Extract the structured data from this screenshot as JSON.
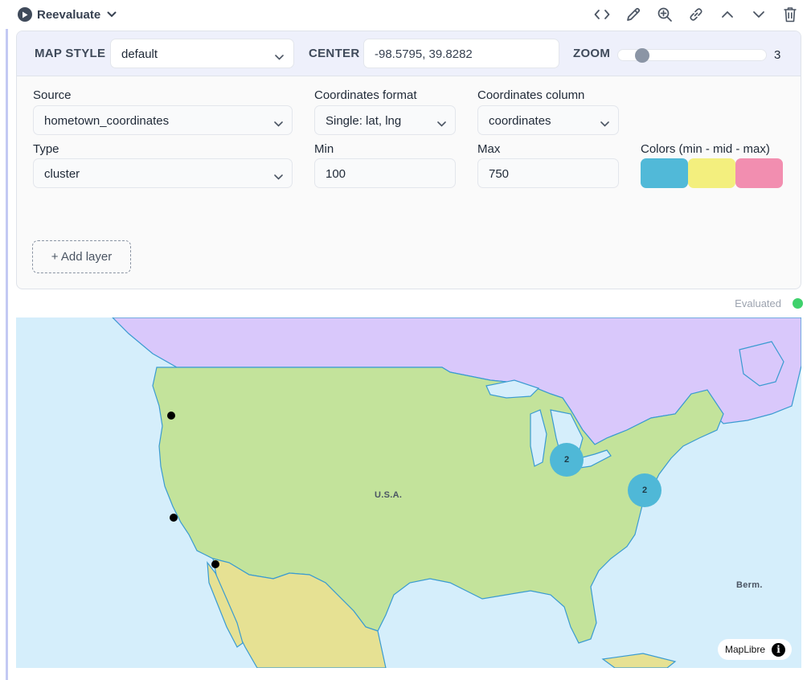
{
  "toolbar": {
    "reevaluate_label": "Reevaluate",
    "actions": [
      "code-icon",
      "pencil-icon",
      "zoom-in-icon",
      "link-icon",
      "chevron-up-icon",
      "chevron-down-icon",
      "trash-icon"
    ]
  },
  "map_config": {
    "map_style_label": "MAP STYLE",
    "map_style_value": "default",
    "center_label": "CENTER",
    "center_value": "-98.5795, 39.8282",
    "zoom_label": "ZOOM",
    "zoom_value": "3"
  },
  "layer": {
    "source_label": "Source",
    "source_value": "hometown_coordinates",
    "coord_format_label": "Coordinates format",
    "coord_format_value": "Single: lat, lng",
    "coord_column_label": "Coordinates column",
    "coord_column_value": "coordinates",
    "type_label": "Type",
    "type_value": "cluster",
    "min_label": "Min",
    "min_value": "100",
    "max_label": "Max",
    "max_value": "750",
    "colors_label": "Colors (min - mid - max)",
    "colors": [
      "#51b9d8",
      "#f3ef7e",
      "#f28eb0"
    ]
  },
  "add_layer_label": "+ Add layer",
  "status": {
    "text": "Evaluated",
    "color": "#3fd16c"
  },
  "map": {
    "labels": {
      "usa": "U.S.A.",
      "bermuda": "Berm."
    },
    "clusters": [
      {
        "count": "2"
      },
      {
        "count": "2"
      }
    ],
    "attribution": "MapLibre",
    "colors": {
      "water": "#d5eefb",
      "usa": "#c3e39b",
      "canada": "#d9c8fb",
      "mexico": "#e6e193",
      "coast": "#3a9bd1"
    }
  }
}
